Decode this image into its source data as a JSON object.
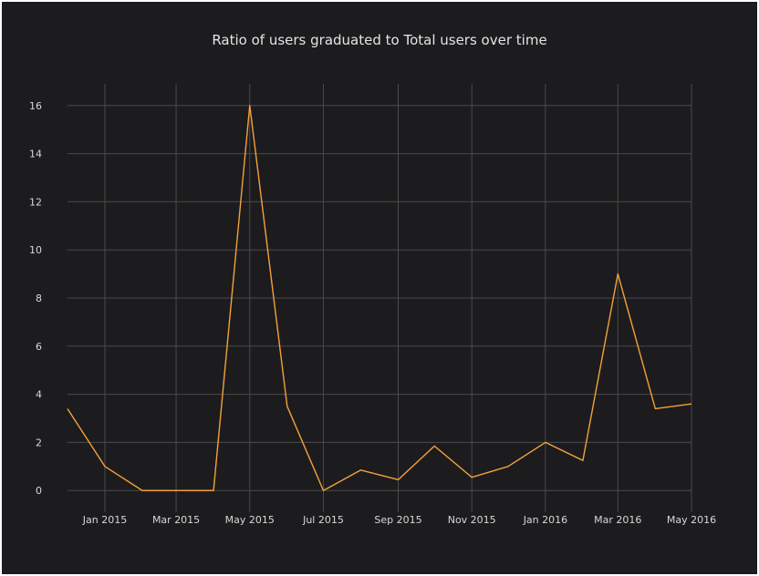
{
  "chart_data": {
    "type": "line",
    "title": "Ratio of users graduated to Total users over time",
    "xlabel": "",
    "ylabel": "",
    "x": [
      "2014-12-01",
      "2015-01-01",
      "2015-02-01",
      "2015-03-01",
      "2015-04-01",
      "2015-05-01",
      "2015-06-01",
      "2015-07-01",
      "2015-08-01",
      "2015-09-01",
      "2015-10-01",
      "2015-11-01",
      "2015-12-01",
      "2016-01-01",
      "2016-02-01",
      "2016-03-01",
      "2016-04-01",
      "2016-05-01"
    ],
    "series": [
      {
        "values": [
          3.4,
          1.0,
          0,
          0,
          0,
          16,
          3.5,
          0,
          0.85,
          0.45,
          1.85,
          0.55,
          1.0,
          2.0,
          1.25,
          9.0,
          3.4,
          3.6
        ],
        "color": "#f5a03c"
      }
    ],
    "x_ticks": [
      {
        "date": "2015-01-01",
        "label": "Jan 2015"
      },
      {
        "date": "2015-03-01",
        "label": "Mar 2015"
      },
      {
        "date": "2015-05-01",
        "label": "May 2015"
      },
      {
        "date": "2015-07-01",
        "label": "Jul 2015"
      },
      {
        "date": "2015-09-01",
        "label": "Sep 2015"
      },
      {
        "date": "2015-11-01",
        "label": "Nov 2015"
      },
      {
        "date": "2016-01-01",
        "label": "Jan 2016"
      },
      {
        "date": "2016-03-01",
        "label": "Mar 2016"
      },
      {
        "date": "2016-05-01",
        "label": "May 2016"
      }
    ],
    "y_ticks": [
      0,
      2,
      4,
      6,
      8,
      10,
      12,
      14,
      16
    ],
    "xlim": [
      "2014-12-01",
      "2016-05-01"
    ],
    "ylim": [
      -0.9,
      16.9
    ],
    "grid": true,
    "legend": "none",
    "colors": {
      "background": "#1c1c1e",
      "grid": "#4a4a4a",
      "line": "#f5a03c",
      "text": "#d8d8d8"
    }
  }
}
